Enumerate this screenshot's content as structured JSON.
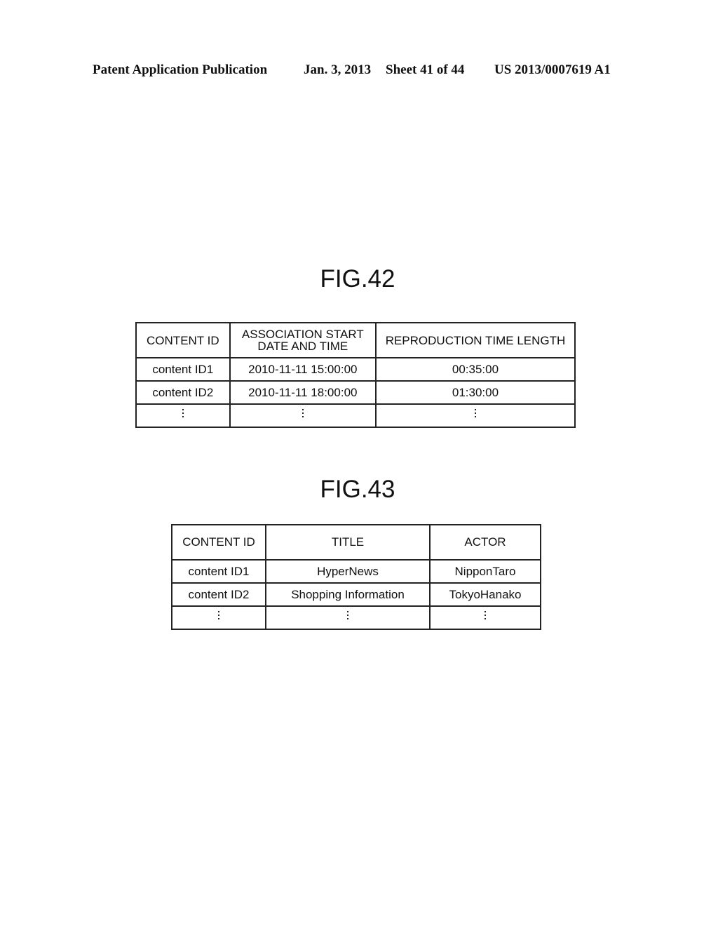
{
  "header": {
    "publication": "Patent Application Publication",
    "date": "Jan. 3, 2013",
    "sheet": "Sheet 41 of 44",
    "number": "US 2013/0007619 A1"
  },
  "fig42": {
    "label": "FIG.42",
    "headers": [
      "CONTENT ID",
      "ASSOCIATION START",
      "DATE AND TIME",
      "REPRODUCTION TIME LENGTH"
    ],
    "rows": [
      [
        "content ID1",
        "2010-11-11 15:00:00",
        "00:35:00"
      ],
      [
        "content ID2",
        "2010-11-11 18:00:00",
        "01:30:00"
      ]
    ],
    "continuation": "⋮"
  },
  "fig43": {
    "label": "FIG.43",
    "headers": [
      "CONTENT ID",
      "TITLE",
      "ACTOR"
    ],
    "rows": [
      [
        "content ID1",
        "HyperNews",
        "NipponTaro"
      ],
      [
        "content ID2",
        "Shopping Information",
        "TokyoHanako"
      ]
    ],
    "continuation": "⋮"
  }
}
